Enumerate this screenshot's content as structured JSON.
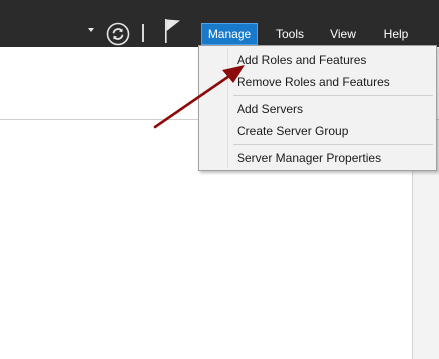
{
  "colors": {
    "titlebar_bg": "#2b2b2b",
    "active_menu_bg": "#1979ca",
    "dropdown_bg": "#f2f2f2",
    "annotation_arrow": "#8b0a0a"
  },
  "header": {
    "icons": [
      "dropdown-caret-icon",
      "refresh-icon",
      "flag-icon"
    ],
    "menu": [
      {
        "label": "Manage",
        "active": true
      },
      {
        "label": "Tools",
        "active": false
      },
      {
        "label": "View",
        "active": false
      },
      {
        "label": "Help",
        "active": false
      }
    ]
  },
  "manage_menu": {
    "items": [
      {
        "label": "Add Roles and Features"
      },
      {
        "label": "Remove Roles and Features"
      },
      {
        "label": "Add Servers"
      },
      {
        "label": "Create Server Group"
      },
      {
        "label": "Server Manager Properties"
      }
    ]
  }
}
